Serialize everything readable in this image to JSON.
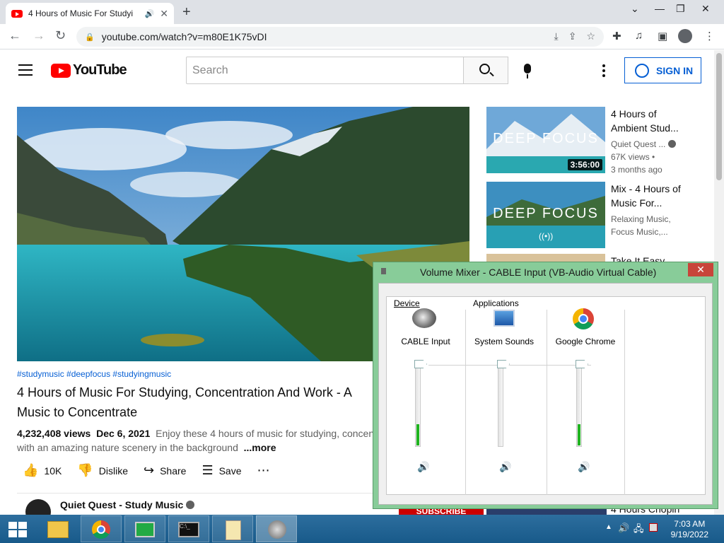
{
  "browser": {
    "tab_title": "4 Hours of Music For Studyi",
    "url": "youtube.com/watch?v=m80E1K75vDI"
  },
  "youtube": {
    "logo_text": "YouTube",
    "search_placeholder": "Search",
    "sign_in": "SIGN IN"
  },
  "video": {
    "hashtags": "#studymusic #deepfocus #studyingmusic",
    "title": "4 Hours of Music For Studying, Concentration And Work - A Music to Concentrate",
    "views": "4,232,408 views",
    "date": "Dec 6, 2021",
    "description": "Enjoy these 4 hours of music for studying, concent with an amazing nature scenery in the background",
    "more": "...more",
    "likes": "10K",
    "dislike": "Dislike",
    "share": "Share",
    "save": "Save",
    "channel": "Quiet Quest - Study Music",
    "subscribe": "SUBSCRIBE"
  },
  "recommendations": [
    {
      "title": "4 Hours of Ambient Stud...",
      "line1": "Quiet Quest ...",
      "line2": "67K views •",
      "line3": "3 months ago",
      "thumb_text": "DEEP FOCUS",
      "duration": "3:56:00"
    },
    {
      "title": "Mix - 4 Hours of Music For...",
      "line1": "Relaxing Music,",
      "line2": "Focus Music,...",
      "line3": "",
      "thumb_text": "DEEP FOCUS",
      "duration": ""
    },
    {
      "title": "Take It Easy",
      "line1": "",
      "line2": "",
      "line3": "",
      "thumb_text": "",
      "duration": ""
    }
  ],
  "partial_bottom_text": "4 Hours Chopin",
  "mixer": {
    "title": "Volume Mixer - CABLE Input (VB-Audio Virtual Cable)",
    "close": "✕",
    "device_label": "Device",
    "applications_label": "Applications",
    "channels": [
      {
        "name": "CABLE Input",
        "level": 0.25,
        "icon": "speaker-device-icon"
      },
      {
        "name": "System Sounds",
        "level": 0.0,
        "icon": "system-sounds-icon"
      },
      {
        "name": "Google Chrome",
        "level": 0.25,
        "icon": "chrome-icon"
      }
    ]
  },
  "taskbar": {
    "time": "7:03 AM",
    "date": "9/19/2022"
  },
  "colors": {
    "yt_red": "#ff0000",
    "link_blue": "#065fd4",
    "mixer_frame": "#88cc99",
    "taskbar": "#1c6aa0"
  }
}
